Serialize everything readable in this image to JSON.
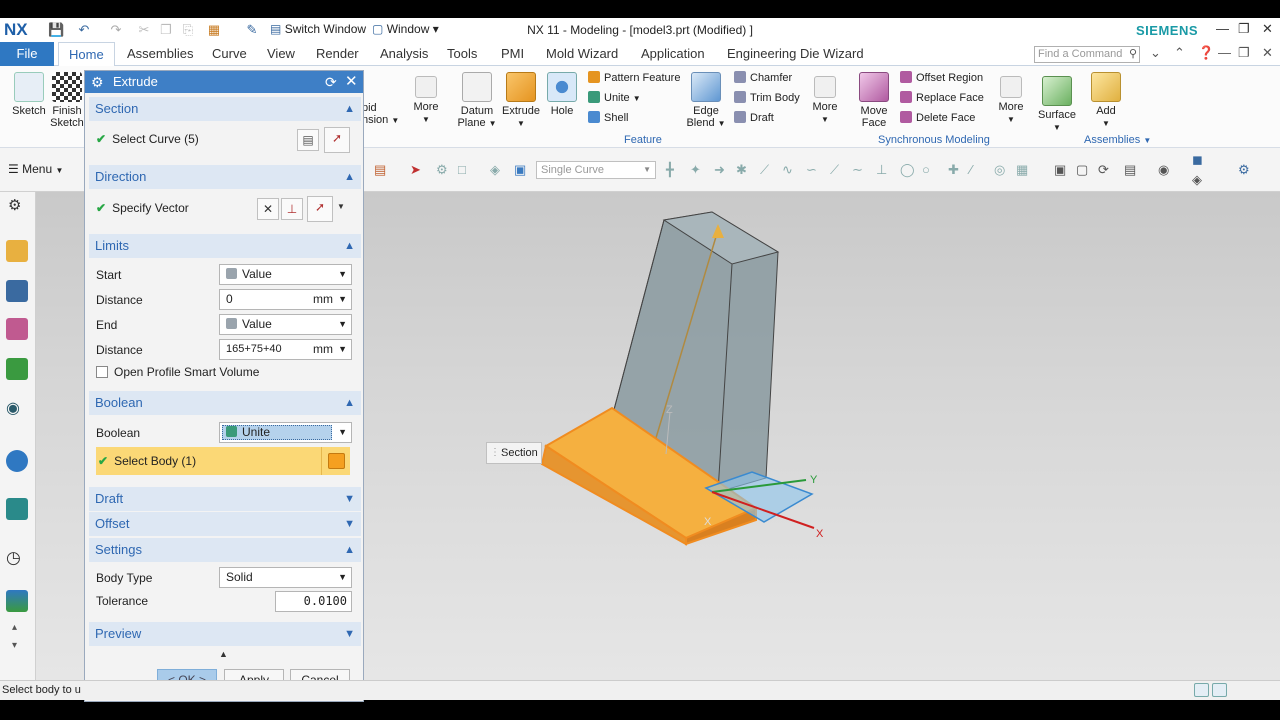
{
  "app": {
    "logo": "NX",
    "window_title": "NX 11 - Modeling - [model3.prt (Modified) ]",
    "brand": "SIEMENS",
    "switch_window": "Switch Window",
    "window_menu": "Window"
  },
  "tabs": {
    "file": "File",
    "items": [
      "Home",
      "Assemblies",
      "Curve",
      "View",
      "Render",
      "Analysis",
      "Tools",
      "PMI",
      "Mold Wizard",
      "Application",
      "Engineering Die Wizard"
    ],
    "active": "Home",
    "find_placeholder": "Find a Command"
  },
  "ribbon": {
    "sketch": "Sketch",
    "finish_sketch_1": "Finish",
    "finish_sketch_2": "Sketch",
    "rapid_1": "pid",
    "rapid_2": "nsion",
    "more1": "More",
    "datum_plane_1": "Datum",
    "datum_plane_2": "Plane",
    "extrude": "Extrude",
    "hole": "Hole",
    "pattern_feature": "Pattern Feature",
    "unite": "Unite",
    "shell": "Shell",
    "edge_blend_1": "Edge",
    "edge_blend_2": "Blend",
    "chamfer": "Chamfer",
    "trim_body": "Trim Body",
    "draft": "Draft",
    "more2": "More",
    "feature_group": "Feature",
    "move_face_1": "Move",
    "move_face_2": "Face",
    "offset_region": "Offset Region",
    "replace_face": "Replace Face",
    "delete_face": "Delete Face",
    "more3": "More",
    "sync_group": "Synchronous Modeling",
    "surface": "Surface",
    "add": "Add",
    "assemblies_group": "Assemblies"
  },
  "toolbar2": {
    "menu": "Menu",
    "selection_filter": "Single Curve"
  },
  "dialog": {
    "title": "Extrude",
    "section": {
      "header": "Section",
      "select_curve": "Select Curve (5)"
    },
    "direction": {
      "header": "Direction",
      "specify_vector": "Specify Vector"
    },
    "limits": {
      "header": "Limits",
      "start_label": "Start",
      "start_value": "Value",
      "start_distance_label": "Distance",
      "start_distance": "0",
      "start_unit": "mm",
      "end_label": "End",
      "end_value": "Value",
      "end_distance_label": "Distance",
      "end_distance": "165+75+40",
      "end_unit": "mm",
      "open_profile": "Open Profile Smart Volume"
    },
    "boolean": {
      "header": "Boolean",
      "label": "Boolean",
      "value": "Unite",
      "select_body": "Select Body (1)"
    },
    "draft": {
      "header": "Draft"
    },
    "offset": {
      "header": "Offset"
    },
    "settings": {
      "header": "Settings",
      "body_type_label": "Body Type",
      "body_type": "Solid",
      "tolerance_label": "Tolerance",
      "tolerance": "0.0100"
    },
    "preview": {
      "header": "Preview"
    },
    "buttons": {
      "ok": "< OK >",
      "apply": "Apply",
      "cancel": "Cancel"
    }
  },
  "graphics": {
    "section_label": "Section",
    "axis_x": "X",
    "axis_y": "Y",
    "axis_z": "Z"
  },
  "status": {
    "text": "Select body to u"
  },
  "colors": {
    "accent": "#3e7fc6",
    "selection": "#fbd876",
    "body_highlight": "#f5a020",
    "brand": "#1a9aa6"
  }
}
